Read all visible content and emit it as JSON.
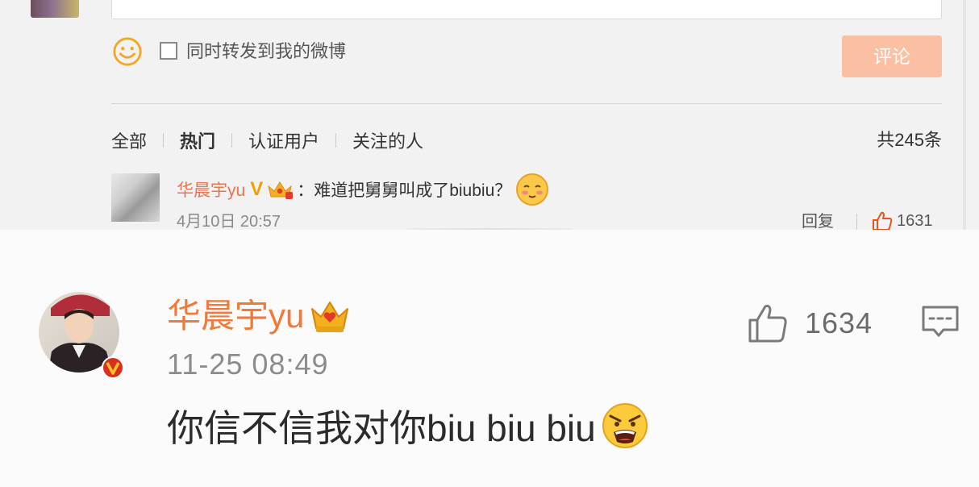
{
  "top": {
    "repost_label": "同时转发到我的微博",
    "submit_label": "评论",
    "tabs": [
      "全部",
      "热门",
      "认证用户",
      "关注的人"
    ],
    "active_tab": "热门",
    "total_count": "共245条",
    "comment": {
      "username": "华晨宇yu",
      "verified_mark": "V",
      "text": "：难道把舅舅叫成了biubiu？",
      "timestamp": "4月10日 20:57",
      "reply_label": "回复",
      "like_count": "1631"
    }
  },
  "comment": {
    "username": "华晨宇yu",
    "timestamp": "11-25 08:49",
    "text": "你信不信我对你biu biu biu",
    "like_count": "1634"
  },
  "colors": {
    "username_orange": "#f07a3a",
    "submit_button": "#fbbfa3",
    "verify_badge": "#d9301e",
    "crown_gold": "#f2b01e"
  },
  "icons": [
    "smile-icon",
    "crown-icon",
    "verified-badge-icon",
    "thumbs-up-icon",
    "reply-icon",
    "angry-emoji-icon",
    "blush-emoji-icon"
  ]
}
